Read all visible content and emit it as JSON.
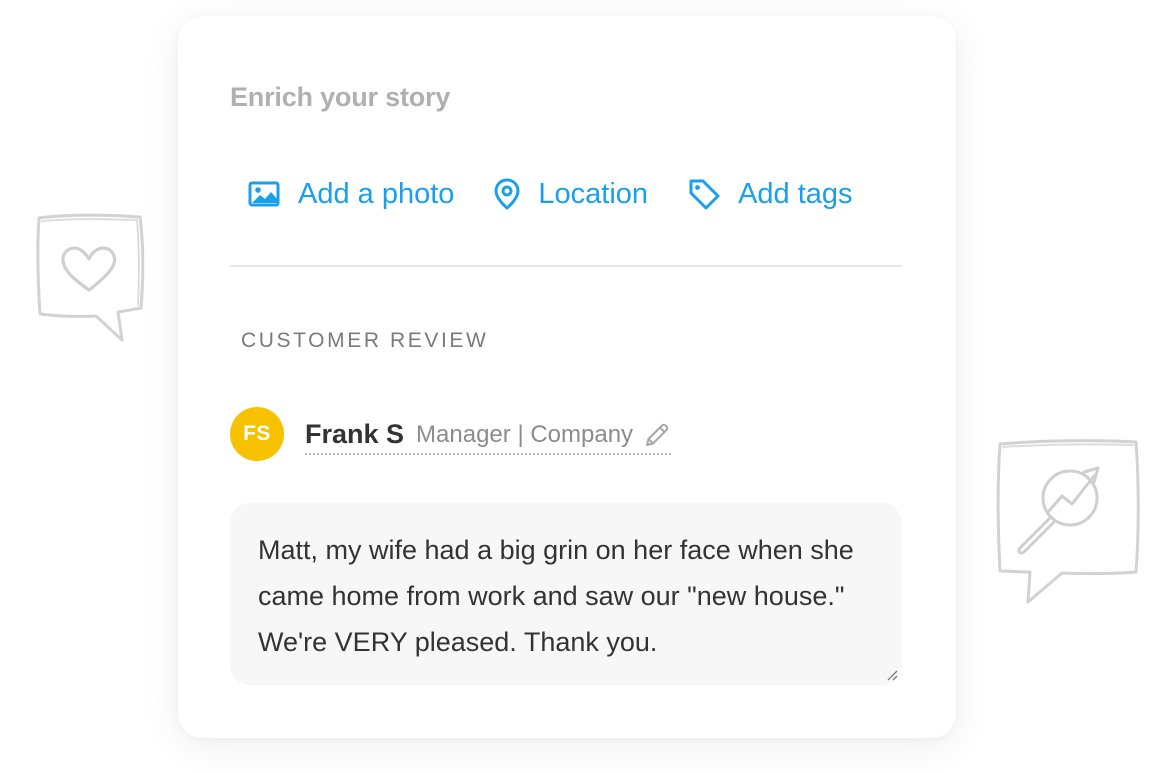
{
  "card": {
    "title": "Enrich your story",
    "actions": [
      {
        "label": "Add a photo",
        "icon": "image-icon"
      },
      {
        "label": "Location",
        "icon": "map-pin-icon"
      },
      {
        "label": "Add tags",
        "icon": "tag-icon"
      }
    ],
    "section_label": "CUSTOMER REVIEW",
    "author": {
      "initials": "FS",
      "name": "Frank S",
      "role": "Manager | Company",
      "edit_icon": "pencil-icon"
    },
    "review_text": "Matt, my wife had a big grin on her face when she came home from work and saw our \"new house.\" We're VERY pleased. Thank you."
  },
  "decorations": {
    "left_icon": "heart-speech-bubble-icon",
    "right_icon": "growth-chart-speech-bubble-icon"
  },
  "colors": {
    "accent": "#1aa0ea",
    "avatar": "#f6c200",
    "title_gray": "#b0b0b0",
    "review_bg": "#f7f7f7"
  }
}
